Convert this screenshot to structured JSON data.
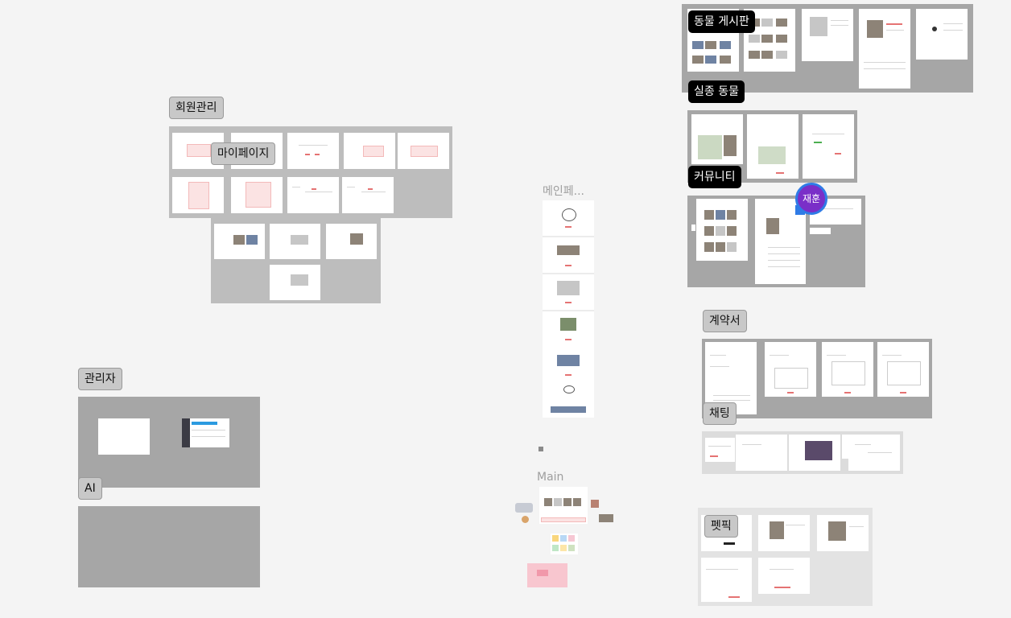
{
  "canvas": {
    "sections": {
      "member": {
        "label": "회원관리"
      },
      "mypage": {
        "label": "마이페이지"
      },
      "admin": {
        "label": "관리자"
      },
      "ai": {
        "label": "AI"
      },
      "main_page": {
        "label": "메인페..."
      },
      "main": {
        "label": "Main"
      },
      "animal_board": {
        "label": "동물 게시판"
      },
      "missing": {
        "label": "실종 동물"
      },
      "community": {
        "label": "커뮤니티"
      },
      "contract": {
        "label": "계약서"
      },
      "chat": {
        "label": "채팅"
      },
      "petpick": {
        "label": "펫픽"
      }
    },
    "collaborator": {
      "name": "재훈",
      "color": "#7a2fc8",
      "ring": "#2f7be6"
    }
  },
  "colors": {
    "canvas": "#f4f4f4",
    "section_dark": "#a6a6a6",
    "section_mid": "#bdbdbd",
    "accent_red": "#e57373"
  }
}
